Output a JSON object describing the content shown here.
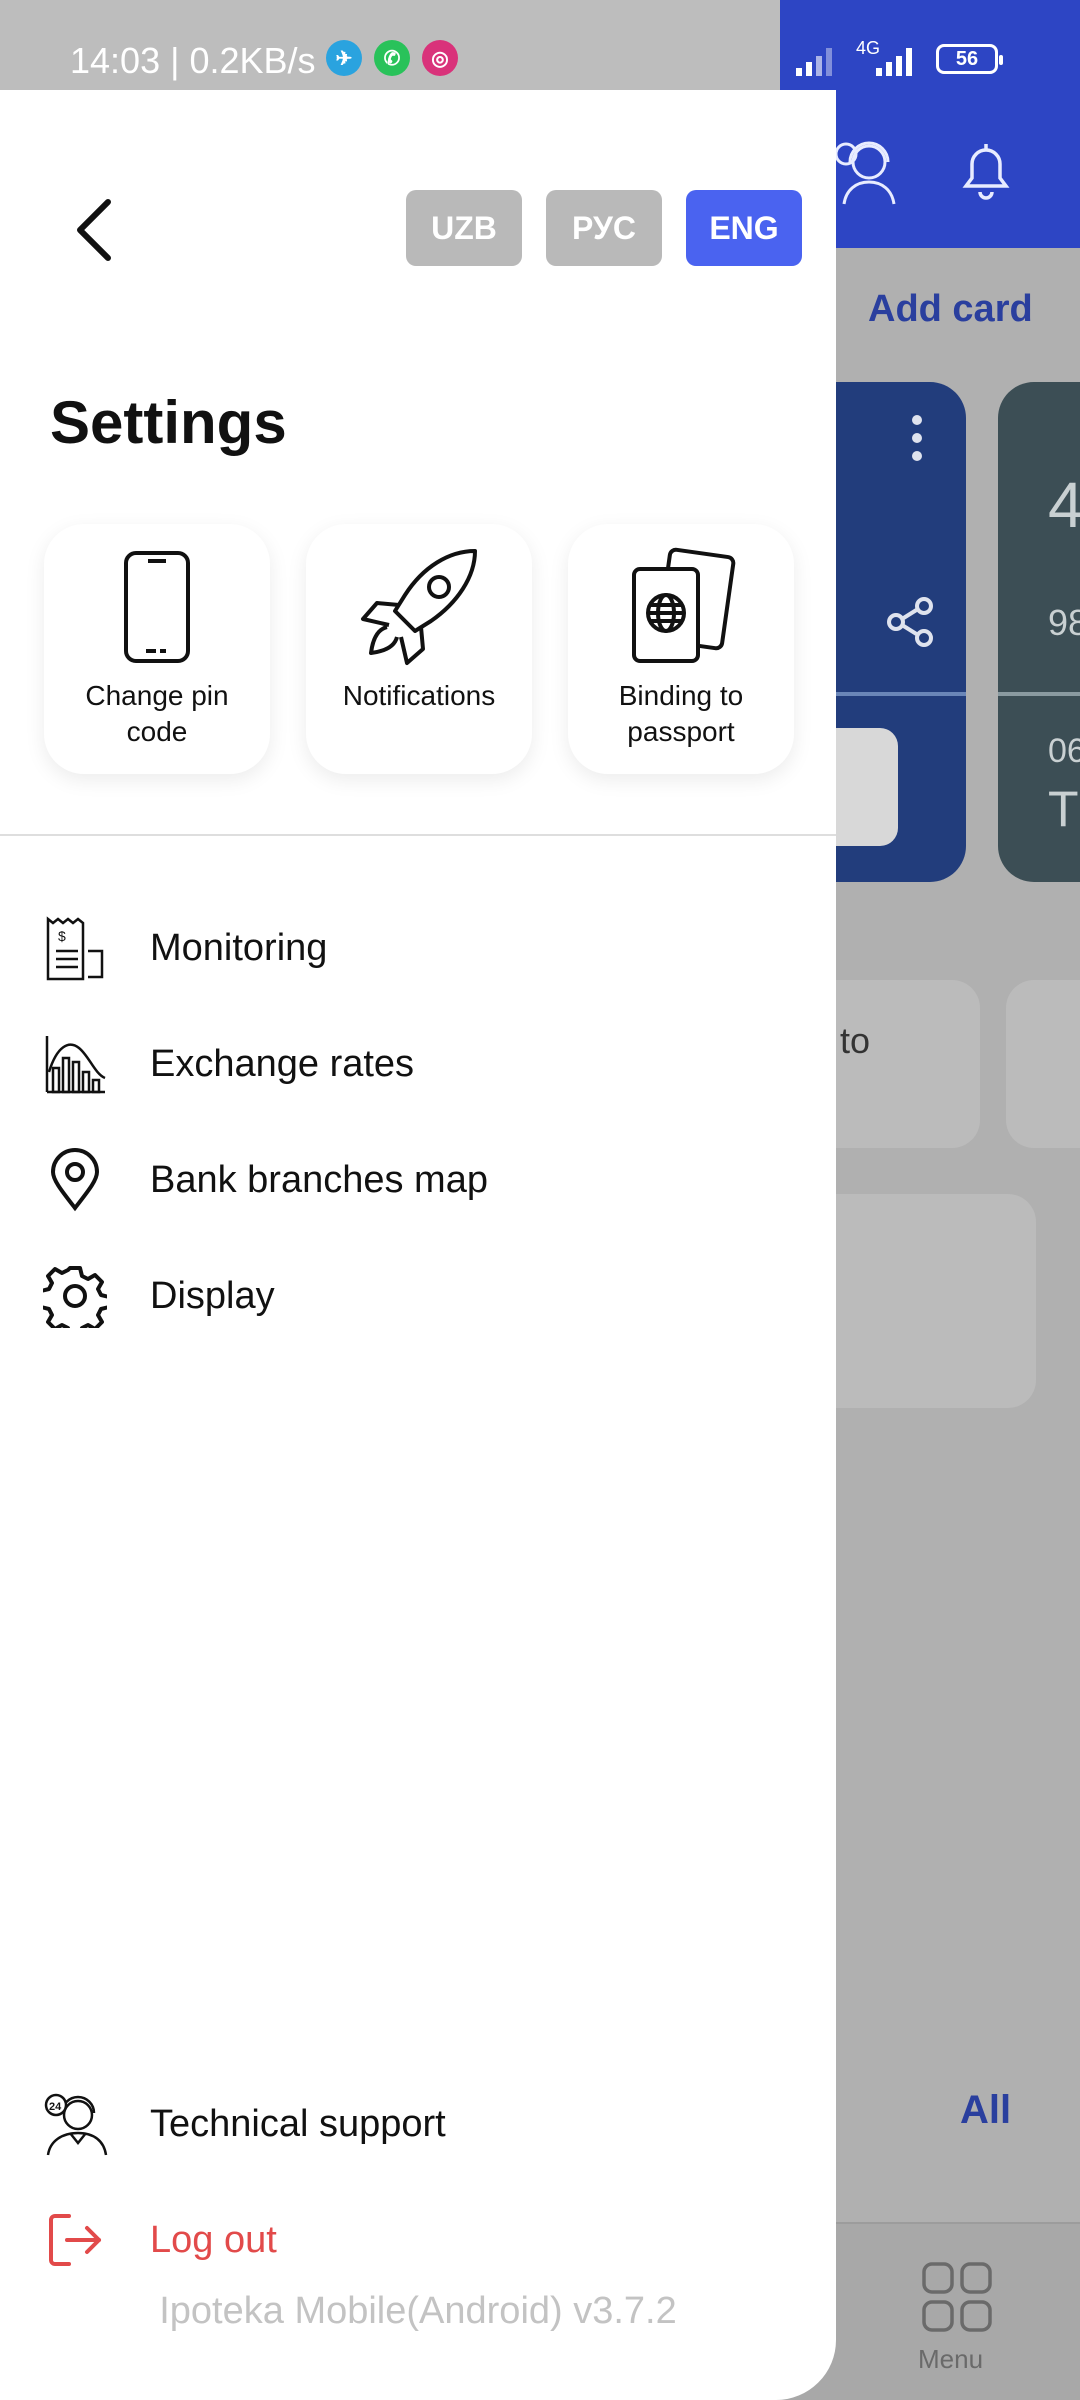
{
  "status_bar": {
    "time": "14:03 | 0.2KB/s",
    "network": "4G",
    "battery": "56"
  },
  "drawer": {
    "languages": [
      {
        "label": "UZB",
        "active": false
      },
      {
        "label": "РУС",
        "active": false
      },
      {
        "label": "ENG",
        "active": true
      }
    ],
    "title": "Settings",
    "quick_tiles": [
      {
        "label": "Change pin code",
        "icon": "smartphone-icon"
      },
      {
        "label": "Notifications",
        "icon": "rocket-icon"
      },
      {
        "label": "Binding to passport",
        "icon": "passport-icon"
      }
    ],
    "menu_items": [
      {
        "label": "Monitoring",
        "icon": "receipt-icon"
      },
      {
        "label": "Exchange rates",
        "icon": "chart-icon"
      },
      {
        "label": "Bank branches map",
        "icon": "map-pin-icon"
      },
      {
        "label": "Display",
        "icon": "gear-icon"
      }
    ],
    "bottom_items": [
      {
        "label": "Technical support",
        "icon": "support-agent-icon"
      },
      {
        "label": "Log out",
        "icon": "logout-icon"
      }
    ],
    "version": "Ipoteka Mobile(Android) v3.7.2"
  },
  "background": {
    "add_card": "Add card",
    "card2_text": [
      "4",
      "98",
      "06",
      "T"
    ],
    "tile_text": "to",
    "all_link": "All",
    "menu_label": "Menu"
  },
  "colors": {
    "accent": "#4a63f0",
    "header_blue": "#2d45c4",
    "logout_red": "#e24a4a",
    "lang_inactive": "#b9b9b9"
  }
}
